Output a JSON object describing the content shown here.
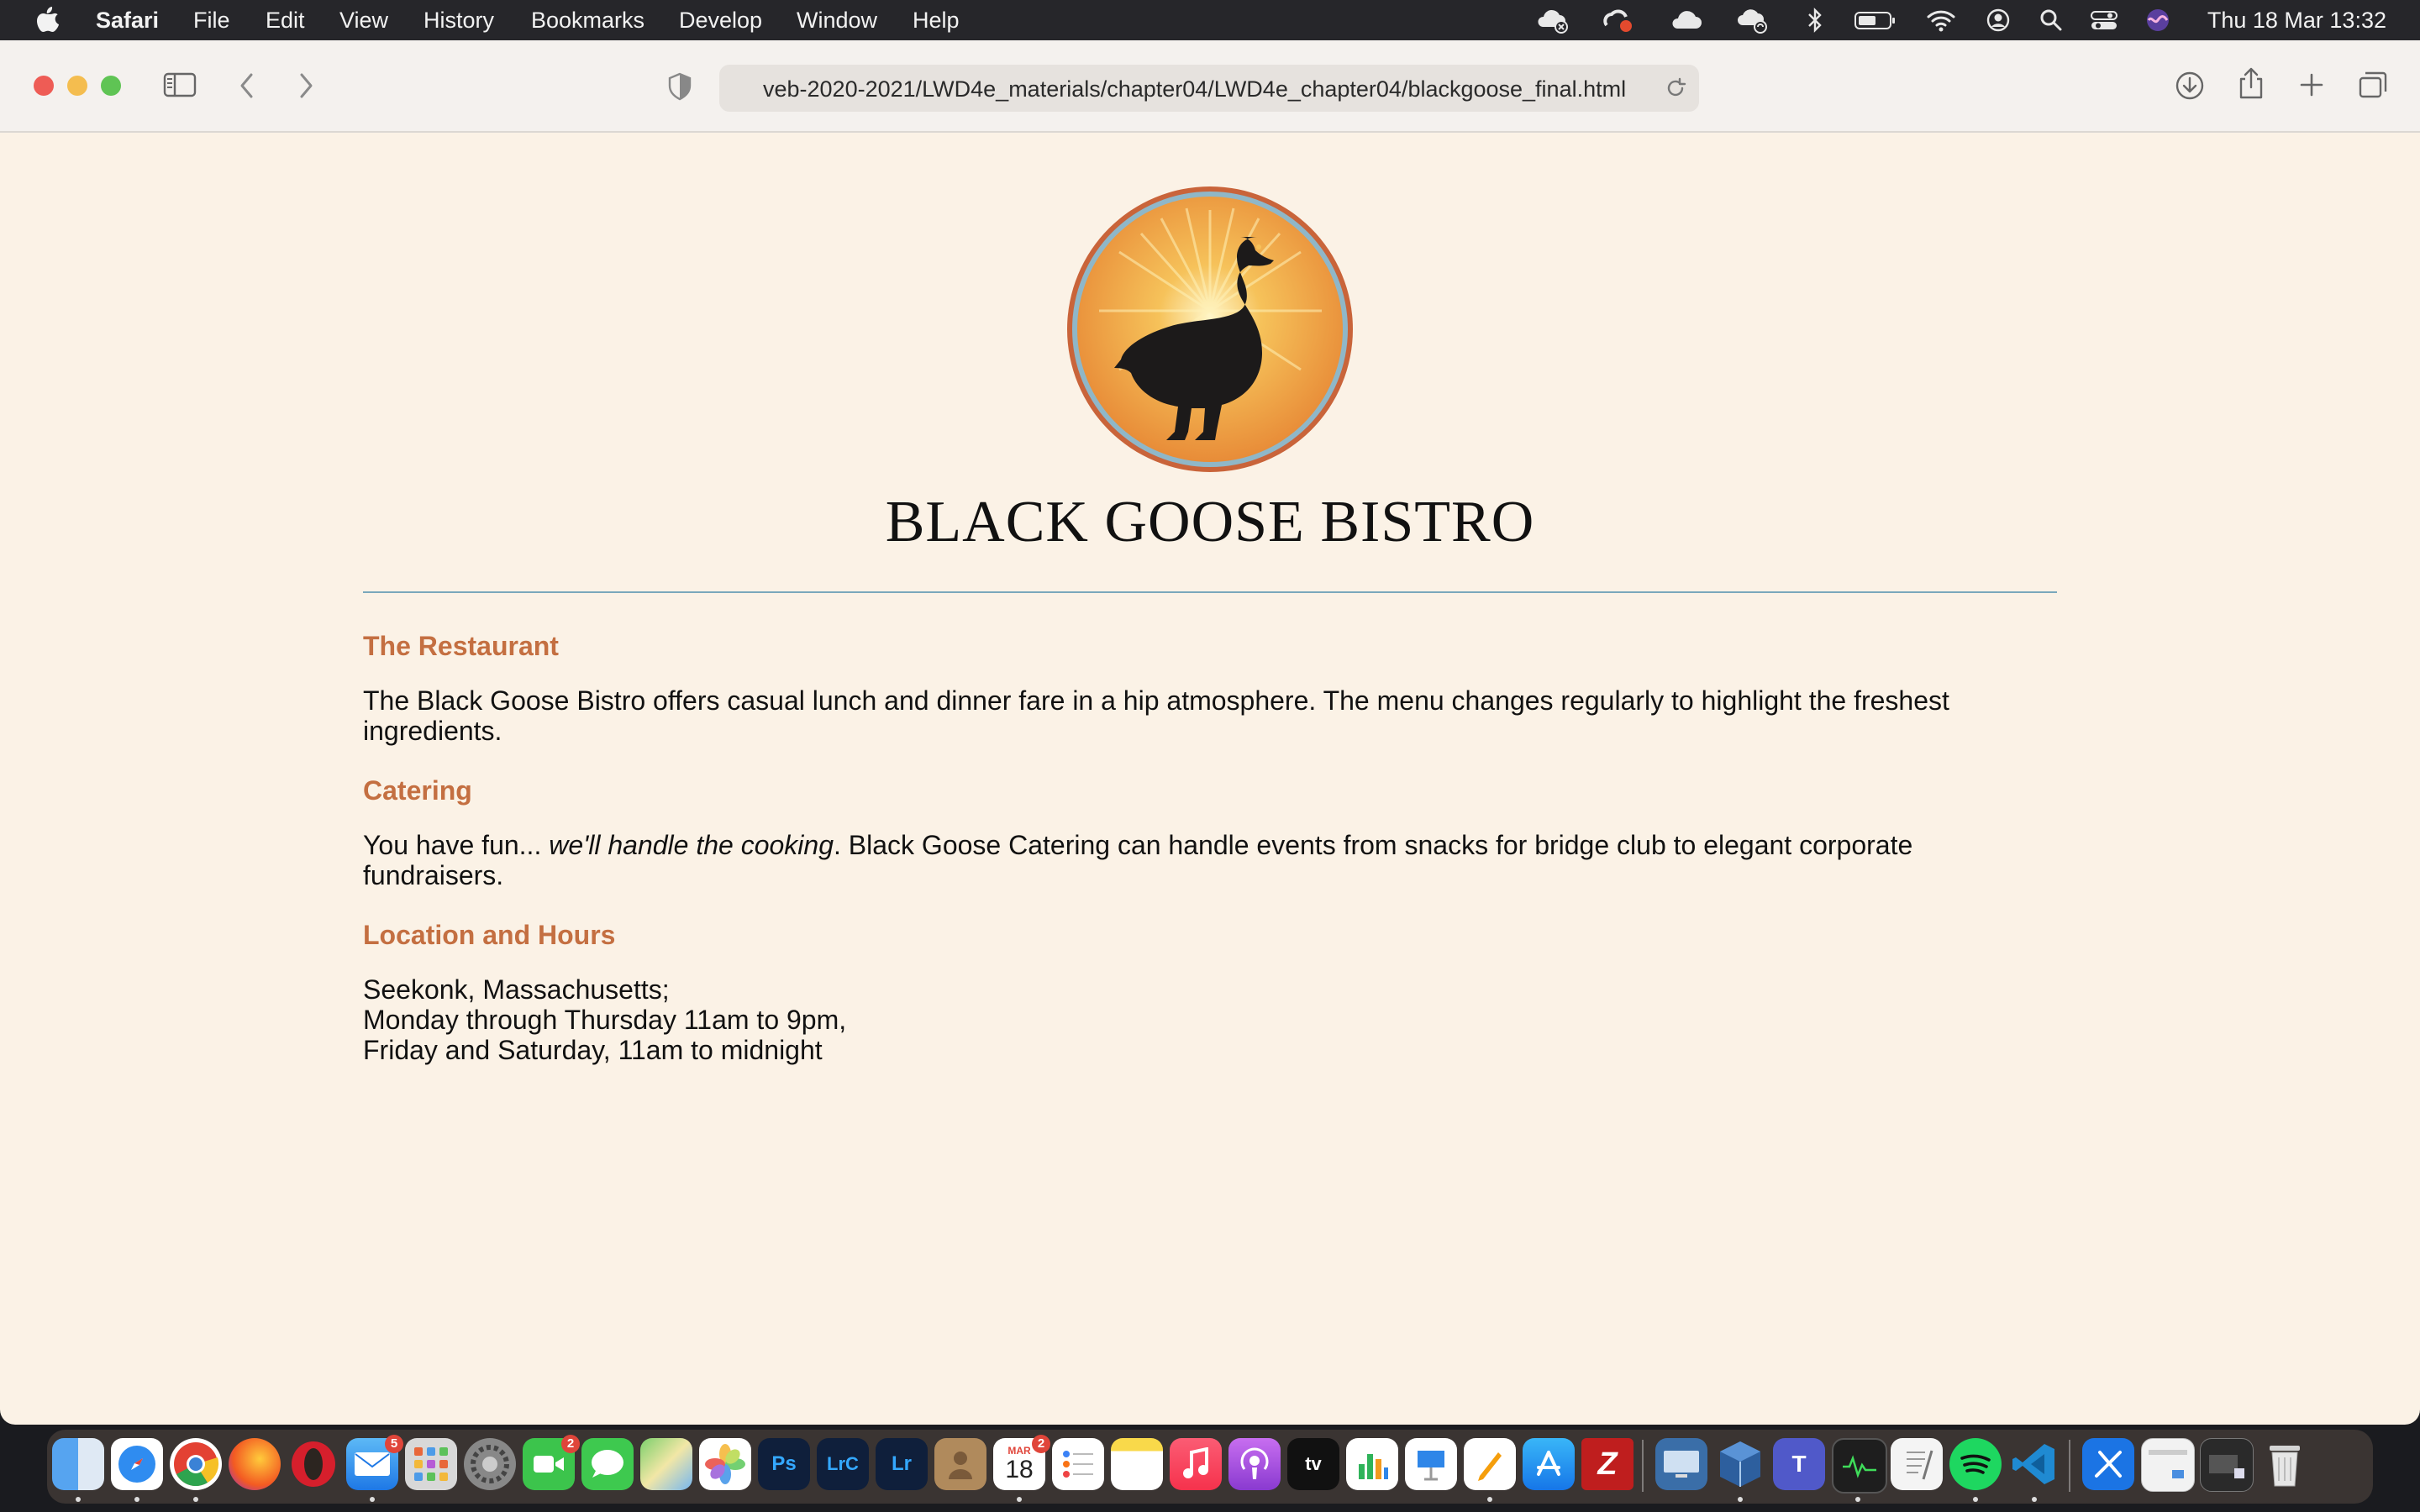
{
  "menubar": {
    "app_name": "Safari",
    "items": [
      "File",
      "Edit",
      "View",
      "History",
      "Bookmarks",
      "Develop",
      "Window",
      "Help"
    ],
    "clock": "Thu 18 Mar  13:32"
  },
  "browser": {
    "url": "veb-2020-2021/LWD4e_materials/chapter04/LWD4e_chapter04/blackgoose_final.html"
  },
  "page": {
    "title": "BLACK GOOSE BISTRO",
    "sections": [
      {
        "heading": "The Restaurant",
        "text": "The Black Goose Bistro offers casual lunch and dinner fare in a hip atmosphere. The menu changes regularly to highlight the freshest ingredients."
      },
      {
        "heading": "Catering",
        "text_before": "You have fun... ",
        "text_em": "we'll handle the cooking",
        "text_after": ". Black Goose Catering can handle events from snacks for bridge club to elegant corporate fundraisers."
      },
      {
        "heading": "Location and Hours",
        "lines": [
          "Seekonk, Massachusetts;",
          "Monday through Thursday 11am to 9pm,",
          "Friday and Saturday, 11am to midnight"
        ]
      }
    ]
  },
  "colors": {
    "page_background": "#fbf2e6",
    "heading": "#c46f41",
    "rule": "#7aa8bc",
    "logo_orange": "#eea04a",
    "logo_ring": "#c9643a"
  },
  "dock": {
    "apps": [
      "Finder",
      "Safari",
      "Chrome",
      "Firefox",
      "Opera",
      "Mail",
      "Launchpad",
      "System Preferences",
      "FaceTime",
      "Messages",
      "Maps",
      "Photos",
      "Ps",
      "LrC",
      "Lr",
      "Contacts",
      "Calendar",
      "Reminders",
      "Notes",
      "Music",
      "Podcasts",
      "TV",
      "Numbers",
      "Keynote",
      "Pages",
      "App Store",
      "FileZilla",
      "Screen Sharing",
      "VirtualBox",
      "Teams",
      "Activity Monitor",
      "TextEdit",
      "Spotify",
      "VS Code",
      "Xcode",
      "Preview",
      "Window",
      "Trash"
    ],
    "mail_badge": "5",
    "facetime_badge": "2",
    "calendar_month": "MAR",
    "calendar_day": "18",
    "calendar_badge": "2",
    "tv_label": "tv",
    "ps_label": "Ps",
    "lrc_label": "LrC",
    "lr_label": "Lr"
  }
}
